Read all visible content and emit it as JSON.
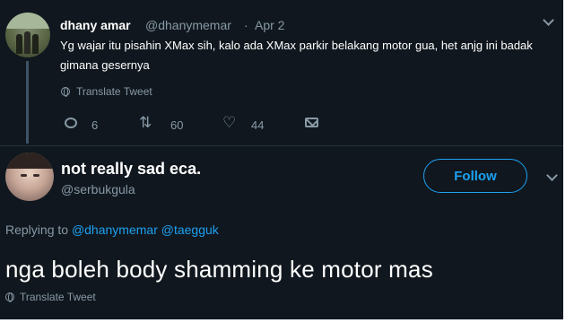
{
  "tweet1": {
    "display_name": "dhany amar",
    "handle": "@dhanymemar",
    "separator": "·",
    "date": "Apr 2",
    "text": "Yg wajar itu pisahin XMax sih, kalo ada XMax parkir belakang motor gua, het anjg ini badak gimana gesernya",
    "translate_label": "Translate Tweet",
    "reply_count": "6",
    "retweet_count": "60",
    "like_count": "44"
  },
  "tweet2": {
    "display_name": "not really sad eca.",
    "handle": "@serbukgula",
    "follow_label": "Follow",
    "replying_prefix": "Replying to",
    "reply_mention_1": "@dhanymemar",
    "reply_mention_2": "@taegguk",
    "text": "nga boleh body shamming ke motor mas",
    "translate_label": "Translate Tweet"
  },
  "colors": {
    "background": "#10171e",
    "accent": "#1da1f2",
    "secondary_text": "#8899a6",
    "primary_text": "#ffffff"
  },
  "icons": [
    "globe-icon",
    "reply-icon",
    "retweet-icon",
    "like-icon",
    "direct-message-icon",
    "chevron-down-icon"
  ]
}
